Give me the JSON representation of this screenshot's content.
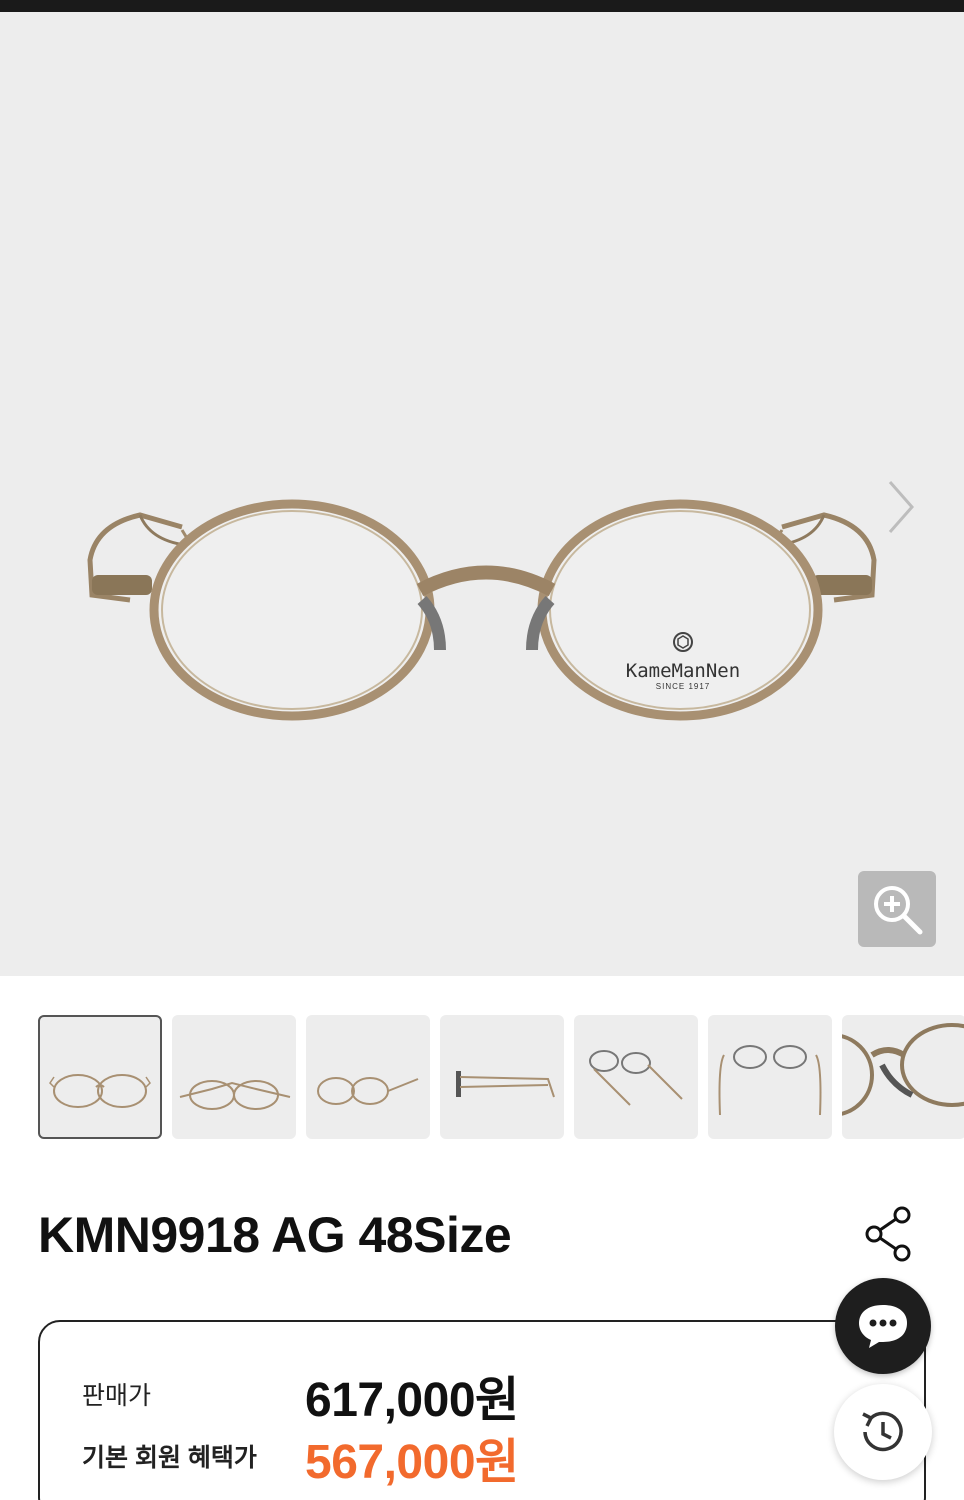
{
  "product": {
    "title": "KMN9918 AG 48Size",
    "brand_logo": "KameManNen",
    "brand_since": "SINCE 1917"
  },
  "gallery": {
    "thumbnail_count": 7,
    "active_index": 0
  },
  "pricing": {
    "sale_label": "판매가",
    "sale_price": "617,000원",
    "member_label": "기본 회원 혜택가",
    "member_price": "567,000원"
  },
  "colors": {
    "hero_bg": "#ededed",
    "frame_gold": "#a89072",
    "member_price": "#f26a2d",
    "chat_button": "#1e1e1e"
  },
  "icons": {
    "next": "chevron-right-icon",
    "zoom": "zoom-in-icon",
    "share": "share-icon",
    "chat": "chat-bubble-icon",
    "history": "history-clock-icon"
  }
}
